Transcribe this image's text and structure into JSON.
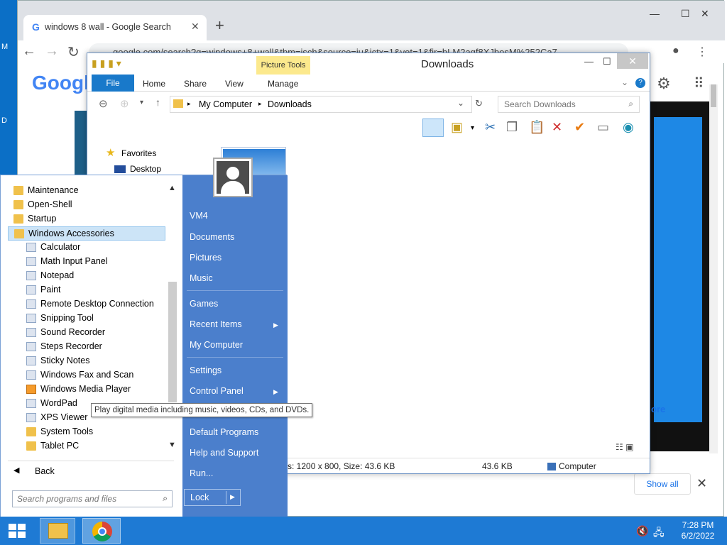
{
  "desktop": {
    "edge_labels": [
      "M",
      "D"
    ]
  },
  "chrome": {
    "tab": {
      "favicon": "G",
      "title": "windows 8 wall - Google Search"
    },
    "new_tab": "+",
    "url": "google.com/search?q=windows+8+wall&tbm=isch&source=iu&ictx=1&vet=1&fir=bLM2agf8XJbosM%252Ca7",
    "logo": "Google",
    "more_link": "ore",
    "show_all": "Show all"
  },
  "explorer": {
    "title": "Downloads",
    "context_tab": "Picture Tools",
    "ribbon_tabs": [
      "File",
      "Home",
      "Share",
      "View",
      "Manage"
    ],
    "breadcrumb": [
      "My Computer",
      "Downloads"
    ],
    "search_placeholder": "Search Downloads",
    "nav": {
      "favorites": "Favorites",
      "desktop": "Desktop"
    },
    "status": {
      "dimensions": "s: 1200 x 800, Size: 43.6 KB",
      "size": "43.6 KB",
      "location": "Computer"
    }
  },
  "start_menu": {
    "programs": [
      {
        "label": "Maintenance",
        "kind": "folder"
      },
      {
        "label": "Open-Shell",
        "kind": "folder"
      },
      {
        "label": "Startup",
        "kind": "folder"
      },
      {
        "label": "Windows Accessories",
        "kind": "folder",
        "selected": true
      },
      {
        "label": "Calculator",
        "kind": "app"
      },
      {
        "label": "Math Input Panel",
        "kind": "app"
      },
      {
        "label": "Notepad",
        "kind": "app"
      },
      {
        "label": "Paint",
        "kind": "app"
      },
      {
        "label": "Remote Desktop Connection",
        "kind": "app"
      },
      {
        "label": "Snipping Tool",
        "kind": "app"
      },
      {
        "label": "Sound Recorder",
        "kind": "app"
      },
      {
        "label": "Steps Recorder",
        "kind": "app"
      },
      {
        "label": "Sticky Notes",
        "kind": "app"
      },
      {
        "label": "Windows Fax and Scan",
        "kind": "app"
      },
      {
        "label": "Windows Media Player",
        "kind": "app"
      },
      {
        "label": "WordPad",
        "kind": "app"
      },
      {
        "label": "XPS Viewer",
        "kind": "app"
      },
      {
        "label": "System Tools",
        "kind": "folder"
      },
      {
        "label": "Tablet PC",
        "kind": "folder"
      }
    ],
    "back": "Back",
    "search_placeholder": "Search programs and files",
    "right_items": [
      {
        "label": "VM4"
      },
      {
        "label": "Documents"
      },
      {
        "label": "Pictures"
      },
      {
        "label": "Music"
      },
      {
        "label": "Games"
      },
      {
        "label": "Recent Items",
        "submenu": true
      },
      {
        "label": "My Computer"
      },
      {
        "label": "Settings"
      },
      {
        "label": "Control Panel",
        "submenu": true
      },
      {
        "label": "Default Programs"
      },
      {
        "label": "Help and Support"
      },
      {
        "label": "Run..."
      }
    ],
    "lock": "Lock",
    "tooltip": "Play digital media including music, videos, CDs, and DVDs."
  },
  "taskbar": {
    "time": "7:28 PM",
    "date": "6/2/2022"
  }
}
